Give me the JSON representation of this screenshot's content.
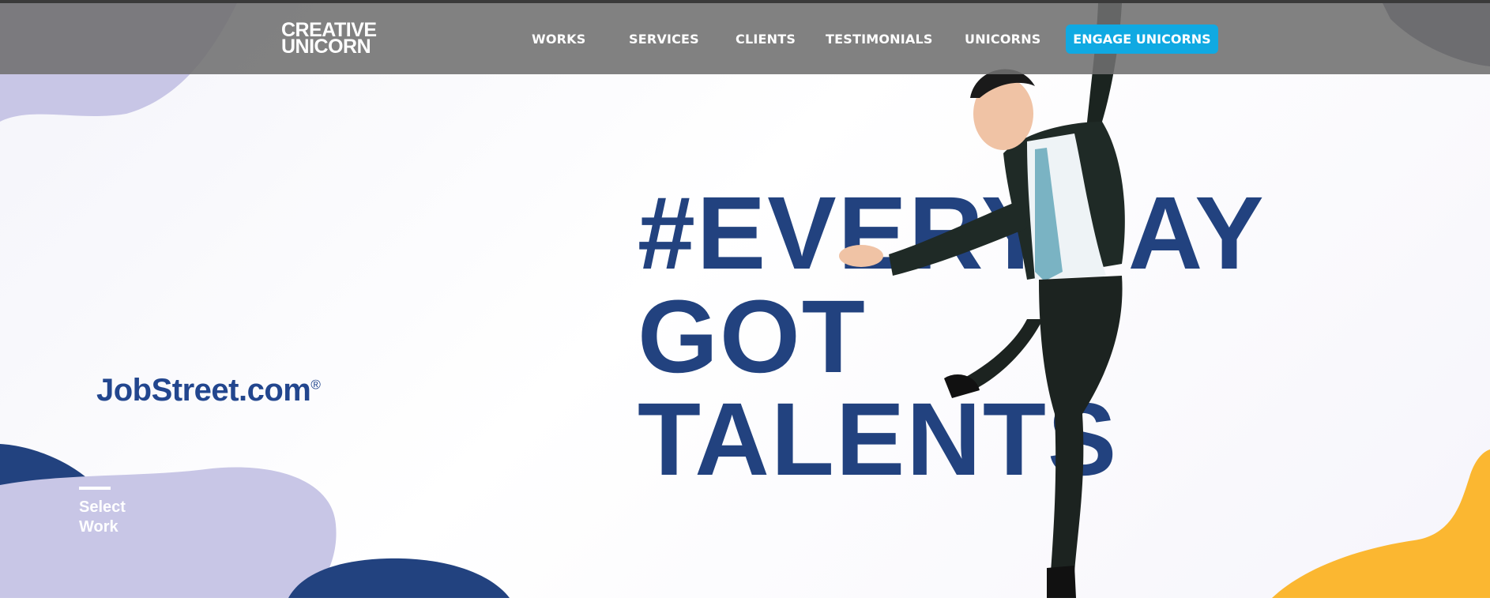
{
  "brand": {
    "logo_line1": "CREATIVE",
    "logo_line2": "UNICORN"
  },
  "nav": {
    "items": [
      "WORKS",
      "SERVICES",
      "CLIENTS",
      "TESTIMONIALS",
      "UNICORNS"
    ],
    "cta_label": "ENGAGE UNICORNS"
  },
  "hero": {
    "headline_line1": "#EVERYDAY",
    "headline_line2": "GOT",
    "headline_line3": "TALENTS",
    "client_logo_text": "JobStreet.com",
    "client_logo_mark": "®",
    "select_work_label": "Select Work",
    "person_image": "man-in-suit-jumping"
  },
  "colors": {
    "navy": "#22427f",
    "lavender": "#c8c6e6",
    "yellow": "#fbb731",
    "cta_blue": "#10a9e2",
    "nav_gray": "#707070"
  }
}
